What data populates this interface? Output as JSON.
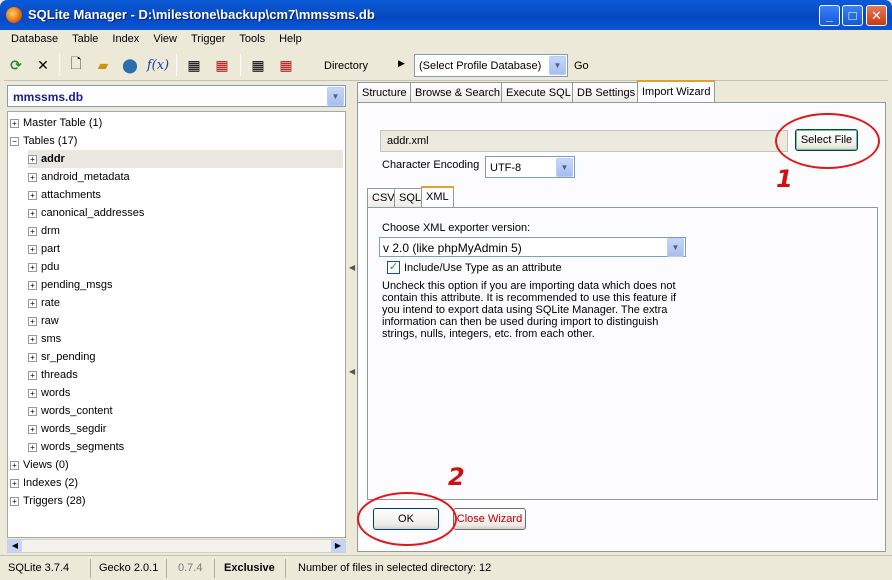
{
  "window": {
    "title": "SQLite Manager - D:\\milestone\\backup\\cm7\\mmssms.db"
  },
  "menu": [
    "Database",
    "Table",
    "Index",
    "View",
    "Trigger",
    "Tools",
    "Help"
  ],
  "toolbar": {
    "directory_label": "Directory",
    "profile_select": "(Select Profile Database)",
    "go_label": "Go"
  },
  "left": {
    "db_name": "mmssms.db",
    "tree": [
      {
        "label": "Master Table (1)",
        "level": 0,
        "expander": "+"
      },
      {
        "label": "Tables (17)",
        "level": 0,
        "expander": "−"
      },
      {
        "label": "addr",
        "level": 1,
        "expander": "+",
        "selected": true
      },
      {
        "label": "android_metadata",
        "level": 1,
        "expander": "+"
      },
      {
        "label": "attachments",
        "level": 1,
        "expander": "+"
      },
      {
        "label": "canonical_addresses",
        "level": 1,
        "expander": "+"
      },
      {
        "label": "drm",
        "level": 1,
        "expander": "+"
      },
      {
        "label": "part",
        "level": 1,
        "expander": "+"
      },
      {
        "label": "pdu",
        "level": 1,
        "expander": "+"
      },
      {
        "label": "pending_msgs",
        "level": 1,
        "expander": "+"
      },
      {
        "label": "rate",
        "level": 1,
        "expander": "+"
      },
      {
        "label": "raw",
        "level": 1,
        "expander": "+"
      },
      {
        "label": "sms",
        "level": 1,
        "expander": "+"
      },
      {
        "label": "sr_pending",
        "level": 1,
        "expander": "+"
      },
      {
        "label": "threads",
        "level": 1,
        "expander": "+"
      },
      {
        "label": "words",
        "level": 1,
        "expander": "+"
      },
      {
        "label": "words_content",
        "level": 1,
        "expander": "+"
      },
      {
        "label": "words_segdir",
        "level": 1,
        "expander": "+"
      },
      {
        "label": "words_segments",
        "level": 1,
        "expander": "+"
      },
      {
        "label": "Views (0)",
        "level": 0,
        "expander": "+"
      },
      {
        "label": "Indexes (2)",
        "level": 0,
        "expander": "+"
      },
      {
        "label": "Triggers (28)",
        "level": 0,
        "expander": "+"
      }
    ]
  },
  "tabs": [
    "Structure",
    "Browse & Search",
    "Execute SQL",
    "DB Settings",
    "Import Wizard"
  ],
  "import": {
    "file_value": "addr.xml",
    "select_file_label": "Select File",
    "encoding_label": "Character Encoding",
    "encoding_value": "UTF-8",
    "subtabs": [
      "CSV",
      "SQL",
      "XML"
    ],
    "xml_version_label": "Choose XML exporter version:",
    "xml_version_value": "v 2.0 (like phpMyAdmin 5)",
    "include_type_label": "Include/Use Type as an attribute",
    "help_text": "Uncheck this option if you are importing data which does not contain this attribute. It is recommended to use this feature if you intend to export data using SQLite Manager. The extra information can then be used during import to distinguish strings, nulls, integers, etc. from each other.",
    "ok_label": "OK",
    "close_wizard_label": "Close Wizard"
  },
  "annotations": {
    "one": "1",
    "two": "2"
  },
  "status": {
    "sqlite_version": "SQLite 3.7.4",
    "gecko_version": "Gecko 2.0.1",
    "app_version": "0.7.4",
    "mode": "Exclusive",
    "files_text": "Number of files in selected directory: 12"
  },
  "colors": {
    "accent_tab": "#e69f27",
    "annotation": "#e01818",
    "close_wizard_text": "#c00000"
  }
}
